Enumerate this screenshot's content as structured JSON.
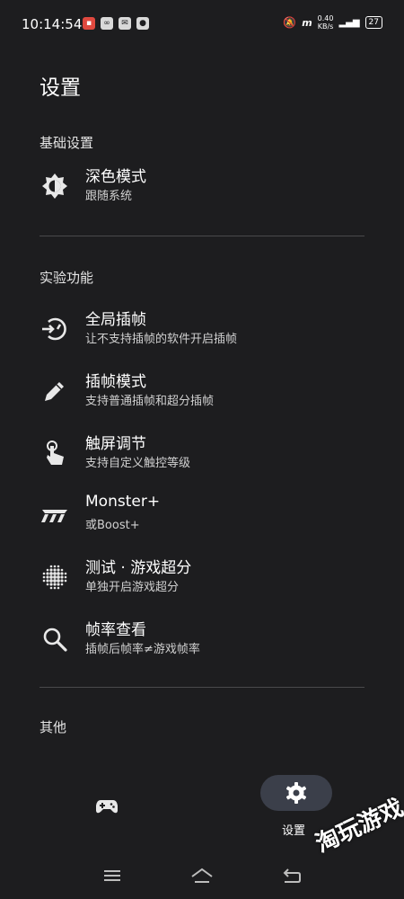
{
  "status": {
    "time": "10:14:54",
    "network_speed": "0.40\nKB/s",
    "battery": "27",
    "icon_names": [
      "notification-app-icon",
      "sync-icon",
      "mail-icon",
      "chat-icon",
      "mute-icon",
      "monster-icon",
      "signal-icon",
      "battery-icon"
    ]
  },
  "page": {
    "title": "设置"
  },
  "sections": [
    {
      "title": "基础设置"
    },
    {
      "title": "实验功能"
    },
    {
      "title": "其他"
    }
  ],
  "items": [
    {
      "title": "深色模式",
      "subtitle": "跟随系统",
      "icon": "brightness-icon"
    },
    {
      "title": "全局插帧",
      "subtitle": "让不支持插帧的软件开启插帧",
      "icon": "timer-icon"
    },
    {
      "title": "插帧模式",
      "subtitle": "支持普通插帧和超分插帧",
      "icon": "pencil-icon"
    },
    {
      "title": "触屏调节",
      "subtitle": "支持自定义触控等级",
      "icon": "touch-icon"
    },
    {
      "title": "Monster+",
      "subtitle": "或Boost+",
      "icon": "monster-icon"
    },
    {
      "title": "测试 · 游戏超分",
      "subtitle": "单独开启游戏超分",
      "icon": "dots-grid-icon"
    },
    {
      "title": "帧率查看",
      "subtitle": "插帧后帧率≠游戏帧率",
      "icon": "search-icon"
    }
  ],
  "bottom_nav": {
    "settings_label": "设置",
    "items": [
      "gamepad-icon",
      "gear-icon"
    ]
  },
  "watermark": "淘玩游戏",
  "colors": {
    "background": "#1d1d1f",
    "divider": "#4a4a4c",
    "active_pill": "#3b3f4a"
  }
}
